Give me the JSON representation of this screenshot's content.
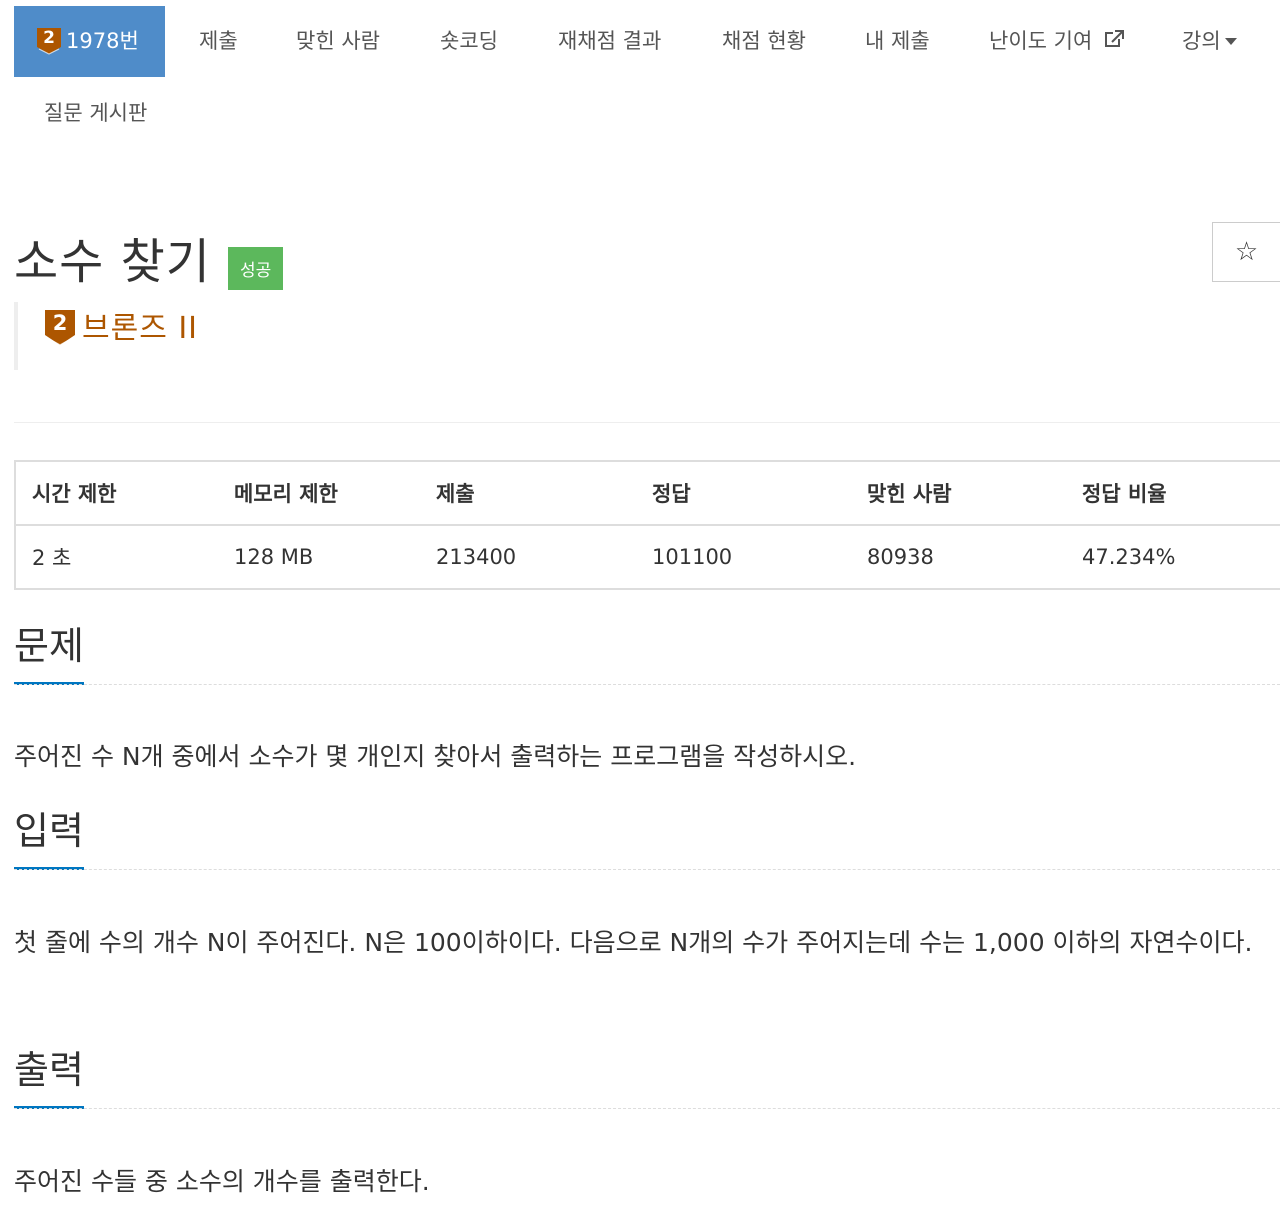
{
  "nav": {
    "problem_tab": {
      "tier_number": "2",
      "label": "1978번"
    },
    "items": [
      "제출",
      "맞힌 사람",
      "숏코딩",
      "재채점 결과",
      "채점 현황",
      "내 제출",
      "난이도 기여",
      "강의"
    ],
    "second_row": [
      "질문 게시판"
    ]
  },
  "problem": {
    "title": "소수 찾기",
    "status_badge": "성공",
    "tier": {
      "number": "2",
      "label": "브론즈 II",
      "color": "#ad5600"
    },
    "favorite_icon": "star-outline-icon"
  },
  "stats_table": {
    "headers": [
      "시간 제한",
      "메모리 제한",
      "제출",
      "정답",
      "맞힌 사람",
      "정답 비율"
    ],
    "row": [
      "2 초",
      "128 MB",
      "213400",
      "101100",
      "80938",
      "47.234%"
    ]
  },
  "sections": {
    "problem": {
      "heading": "문제",
      "text": "주어진 수 N개 중에서 소수가 몇 개인지 찾아서 출력하는 프로그램을 작성하시오."
    },
    "input": {
      "heading": "입력",
      "text": "첫 줄에 수의 개수 N이 주어진다. N은 100이하이다. 다음으로 N개의 수가 주어지는데 수는 1,000 이하의 자연수이다."
    },
    "output": {
      "heading": "출력",
      "text": "주어진 수들 중 소수의 개수를 출력한다."
    }
  },
  "colors": {
    "nav_active": "#4f8cc9",
    "success": "#5cb85c",
    "bronze": "#ad5600",
    "section_underline": "#0076c0"
  }
}
